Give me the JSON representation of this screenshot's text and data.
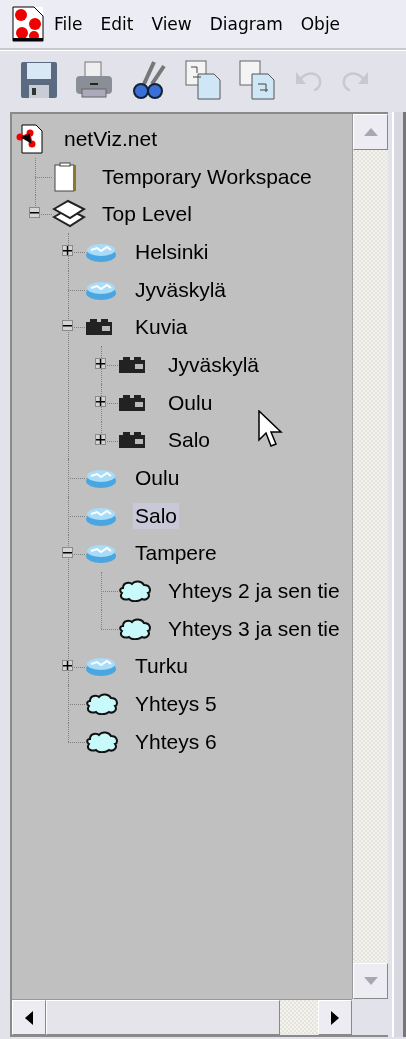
{
  "menu_bar": {
    "items": [
      "File",
      "Edit",
      "View",
      "Diagram",
      "Obje"
    ]
  },
  "toolbar": {
    "buttons": [
      {
        "kind": "save",
        "disabled": false
      },
      {
        "kind": "print",
        "disabled": false
      },
      {
        "kind": "cut",
        "disabled": false
      },
      {
        "kind": "copy",
        "disabled": false
      },
      {
        "kind": "paste",
        "disabled": false
      },
      {
        "kind": "undo",
        "disabled": true
      },
      {
        "kind": "redo",
        "disabled": true
      }
    ]
  },
  "tree": {
    "root": {
      "label": "netViz.net",
      "kind": "root",
      "selected": false,
      "children": [
        {
          "label": "Temporary Workspace",
          "kind": "workspace",
          "selected": false
        },
        {
          "label": "Top Level",
          "kind": "layer",
          "selected": false,
          "expanded": true,
          "children": [
            {
              "label": "Helsinki",
              "kind": "site",
              "selected": false,
              "expanded": false
            },
            {
              "label": "Jyväskylä",
              "kind": "site",
              "selected": false
            },
            {
              "label": "Kuvia",
              "kind": "folder",
              "selected": false,
              "expanded": true,
              "children": [
                {
                  "label": "Jyväskylä",
                  "kind": "folder",
                  "selected": false,
                  "expanded": false
                },
                {
                  "label": "Oulu",
                  "kind": "folder",
                  "selected": false,
                  "expanded": false
                },
                {
                  "label": "Salo",
                  "kind": "folder",
                  "selected": false,
                  "expanded": false
                }
              ]
            },
            {
              "label": "Oulu",
              "kind": "site",
              "selected": false
            },
            {
              "label": "Salo",
              "kind": "site",
              "selected": true
            },
            {
              "label": "Tampere",
              "kind": "site",
              "selected": false,
              "expanded": true,
              "children": [
                {
                  "label": "Yhteys 2 ja sen tie",
                  "kind": "link",
                  "selected": false
                },
                {
                  "label": "Yhteys 3 ja sen tie",
                  "kind": "link",
                  "selected": false
                }
              ]
            },
            {
              "label": "Turku",
              "kind": "site",
              "selected": false,
              "expanded": false
            },
            {
              "label": "Yhteys 5",
              "kind": "link",
              "selected": false
            },
            {
              "label": "Yhteys 6",
              "kind": "link",
              "selected": false
            }
          ]
        }
      ]
    }
  }
}
